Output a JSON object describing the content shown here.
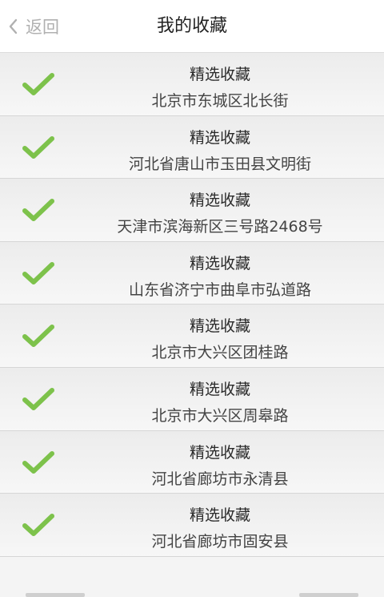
{
  "header": {
    "back_label": "返回",
    "title": "我的收藏"
  },
  "colors": {
    "check": "#7dc24b",
    "header_bg": "#ffffff",
    "list_bg": "#f4f4f4"
  },
  "favorites": [
    {
      "title": "精选收藏",
      "address": "北京市东城区北长街",
      "icon": "check-icon"
    },
    {
      "title": "精选收藏",
      "address": "河北省唐山市玉田县文明街",
      "icon": "check-icon"
    },
    {
      "title": "精选收藏",
      "address": "天津市滨海新区三号路2468号",
      "icon": "check-icon"
    },
    {
      "title": "精选收藏",
      "address": "山东省济宁市曲阜市弘道路",
      "icon": "check-icon"
    },
    {
      "title": "精选收藏",
      "address": "北京市大兴区团桂路",
      "icon": "check-icon"
    },
    {
      "title": "精选收藏",
      "address": "北京市大兴区周皋路",
      "icon": "check-icon"
    },
    {
      "title": "精选收藏",
      "address": "河北省廊坊市永清县",
      "icon": "check-icon"
    },
    {
      "title": "精选收藏",
      "address": "河北省廊坊市固安县",
      "icon": "check-icon"
    }
  ]
}
